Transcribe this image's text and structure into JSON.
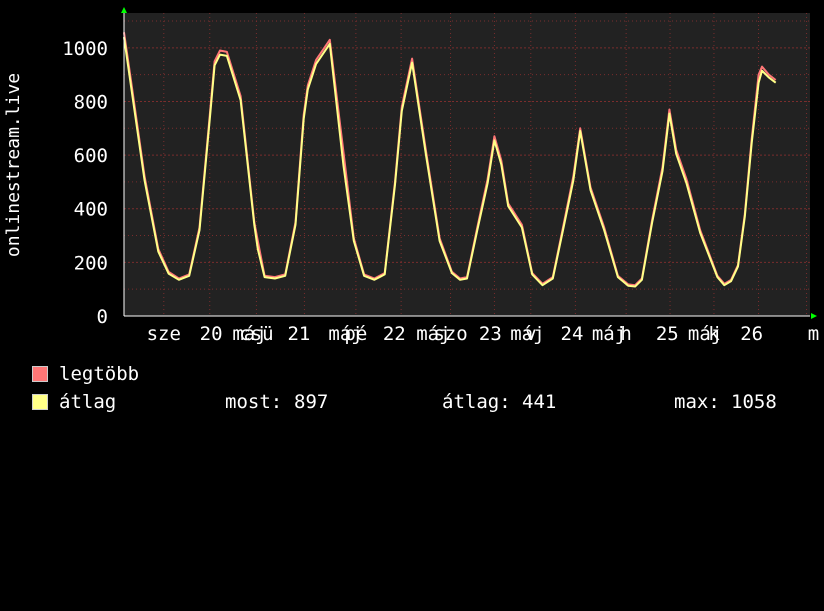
{
  "theme": {
    "background": "#000000",
    "plot_background": "#222222",
    "grid_color": "#7a2d2d",
    "text_color": "#ffffff",
    "max_color": "#ff7777",
    "avg_color": "#ffff88",
    "arrow_color": "#00ff00"
  },
  "chart_data": {
    "type": "line",
    "ylabel": "onlinestream.live",
    "ylim": [
      0,
      1130
    ],
    "yticks": [
      0,
      200,
      400,
      600,
      800,
      1000
    ],
    "xlim": [
      0,
      1
    ],
    "xticks": [
      {
        "label": "sze",
        "x": 0.058
      },
      {
        "label": "20",
        "x": 0.127
      },
      {
        "label": "máj",
        "x": 0.183
      },
      {
        "label": "csü",
        "x": 0.193
      },
      {
        "label": "21",
        "x": 0.255
      },
      {
        "label": "máj",
        "x": 0.323
      },
      {
        "label": "pé",
        "x": 0.338
      },
      {
        "label": "22",
        "x": 0.394
      },
      {
        "label": "máj",
        "x": 0.451
      },
      {
        "label": "szo",
        "x": 0.476
      },
      {
        "label": "23",
        "x": 0.534
      },
      {
        "label": "máj",
        "x": 0.588
      },
      {
        "label": "v",
        "x": 0.593
      },
      {
        "label": "24",
        "x": 0.653
      },
      {
        "label": "máj",
        "x": 0.707
      },
      {
        "label": "h",
        "x": 0.732
      },
      {
        "label": "25",
        "x": 0.792
      },
      {
        "label": "máj",
        "x": 0.847
      },
      {
        "label": "k",
        "x": 0.86
      },
      {
        "label": "26",
        "x": 0.915
      },
      {
        "label": "m",
        "x": 1.005
      }
    ],
    "vgrid": [
      0.058,
      0.125,
      0.193,
      0.263,
      0.338,
      0.404,
      0.476,
      0.54,
      0.593,
      0.658,
      0.732,
      0.796,
      0.86,
      0.925,
      0.995
    ],
    "series": [
      {
        "name": "legtöbb",
        "color": "#ff7777",
        "x": [
          0.0,
          0.01,
          0.03,
          0.05,
          0.065,
          0.08,
          0.095,
          0.11,
          0.125,
          0.132,
          0.14,
          0.15,
          0.17,
          0.19,
          0.195,
          0.205,
          0.22,
          0.235,
          0.25,
          0.262,
          0.268,
          0.28,
          0.3,
          0.32,
          0.335,
          0.35,
          0.365,
          0.38,
          0.395,
          0.405,
          0.42,
          0.44,
          0.46,
          0.478,
          0.49,
          0.5,
          0.515,
          0.53,
          0.54,
          0.55,
          0.56,
          0.58,
          0.595,
          0.61,
          0.625,
          0.64,
          0.655,
          0.665,
          0.68,
          0.7,
          0.72,
          0.735,
          0.745,
          0.755,
          0.77,
          0.785,
          0.795,
          0.805,
          0.82,
          0.84,
          0.865,
          0.875,
          0.885,
          0.895,
          0.905,
          0.915,
          0.925,
          0.93,
          0.94,
          0.95
        ],
        "values": [
          1058,
          880,
          520,
          250,
          165,
          140,
          155,
          330,
          750,
          950,
          990,
          985,
          820,
          350,
          280,
          150,
          145,
          155,
          350,
          750,
          860,
          955,
          1030,
          610,
          290,
          155,
          140,
          160,
          500,
          780,
          960,
          620,
          290,
          165,
          140,
          145,
          330,
          510,
          670,
          580,
          420,
          340,
          160,
          120,
          145,
          330,
          520,
          700,
          480,
          330,
          150,
          118,
          115,
          140,
          360,
          555,
          770,
          620,
          510,
          320,
          150,
          120,
          135,
          190,
          380,
          660,
          900,
          930,
          900,
          880
        ]
      },
      {
        "name": "átlag",
        "color": "#ffff88",
        "x": [
          0.0,
          0.01,
          0.03,
          0.05,
          0.065,
          0.08,
          0.095,
          0.11,
          0.125,
          0.132,
          0.14,
          0.15,
          0.17,
          0.19,
          0.195,
          0.205,
          0.22,
          0.235,
          0.25,
          0.262,
          0.268,
          0.28,
          0.3,
          0.32,
          0.335,
          0.35,
          0.365,
          0.38,
          0.395,
          0.405,
          0.42,
          0.44,
          0.46,
          0.478,
          0.49,
          0.5,
          0.515,
          0.53,
          0.54,
          0.55,
          0.56,
          0.58,
          0.595,
          0.61,
          0.625,
          0.64,
          0.655,
          0.665,
          0.68,
          0.7,
          0.72,
          0.735,
          0.745,
          0.755,
          0.77,
          0.785,
          0.795,
          0.805,
          0.82,
          0.84,
          0.865,
          0.875,
          0.885,
          0.895,
          0.905,
          0.915,
          0.925,
          0.93,
          0.94,
          0.95
        ],
        "values": [
          1040,
          860,
          505,
          240,
          158,
          135,
          150,
          320,
          735,
          935,
          975,
          970,
          805,
          340,
          250,
          145,
          140,
          150,
          340,
          735,
          845,
          940,
          1015,
          560,
          280,
          150,
          135,
          155,
          490,
          765,
          945,
          605,
          280,
          160,
          135,
          140,
          320,
          495,
          655,
          565,
          410,
          330,
          155,
          115,
          140,
          320,
          505,
          690,
          470,
          320,
          145,
          113,
          110,
          135,
          350,
          540,
          755,
          605,
          495,
          310,
          145,
          115,
          130,
          185,
          370,
          645,
          870,
          915,
          890,
          870
        ]
      }
    ],
    "stats": {
      "most_label": "most:",
      "most_value": "897",
      "avg_label": "átlag:",
      "avg_value": "441",
      "max_label": "max:",
      "max_value": "1058"
    },
    "grid": true,
    "legend_position": "bottom-left"
  }
}
